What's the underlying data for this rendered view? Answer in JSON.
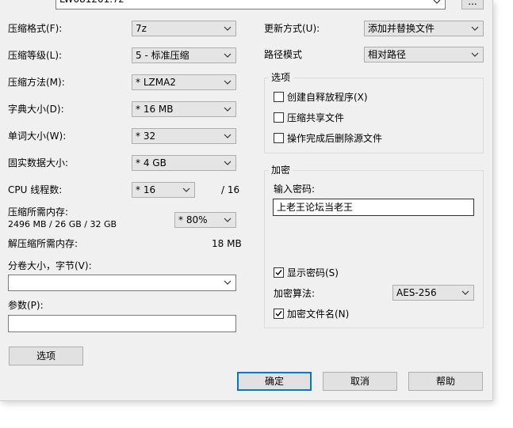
{
  "archive": {
    "filename": "LW081201.7z",
    "browse_label": "..."
  },
  "left": {
    "format": {
      "label": "压缩格式(F):",
      "value": "7z"
    },
    "level": {
      "label": "压缩等级(L):",
      "value": "5 - 标准压缩"
    },
    "method": {
      "label": "压缩方法(M):",
      "value": "* LZMA2"
    },
    "dict": {
      "label": "字典大小(D):",
      "value": "* 16 MB"
    },
    "word": {
      "label": "单词大小(W):",
      "value": "* 32"
    },
    "solid": {
      "label": "固实数据大小:",
      "value": "* 4 GB"
    },
    "threads": {
      "label": "CPU 线程数:",
      "value": "* 16",
      "max": "/ 16"
    },
    "memory": {
      "label": "压缩所需内存:",
      "detail": "2496 MB / 26 GB / 32 GB",
      "value": "* 80%"
    },
    "decompress": {
      "label": "解压缩所需内存:",
      "value": "18 MB"
    },
    "volume": {
      "label": "分卷大小，字节(V):",
      "value": ""
    },
    "params": {
      "label": "参数(P):",
      "value": ""
    },
    "options_button": "选项"
  },
  "right": {
    "update": {
      "label": "更新方式(U):",
      "value": "添加并替换文件"
    },
    "path": {
      "label": "路径模式",
      "value": "相对路径"
    },
    "options": {
      "title": "选项",
      "items": [
        {
          "label": "创建自释放程序(X)",
          "checked": false
        },
        {
          "label": "压缩共享文件",
          "checked": false
        },
        {
          "label": "操作完成后删除源文件",
          "checked": false
        }
      ]
    },
    "encryption": {
      "title": "加密",
      "password_label": "输入密码:",
      "password_value": "上老王论坛当老王",
      "show_password": {
        "label": "显示密码(S)",
        "checked": true
      },
      "method_label": "加密算法:",
      "method_value": "AES-256",
      "encrypt_names": {
        "label": "加密文件名(N)",
        "checked": true
      }
    }
  },
  "buttons": {
    "ok": "确定",
    "cancel": "取消",
    "help": "帮助"
  }
}
